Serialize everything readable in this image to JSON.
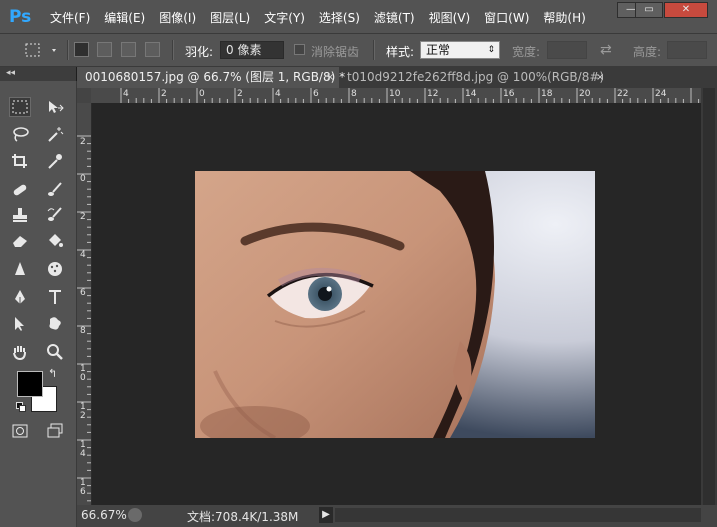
{
  "app": {
    "logo": "Ps"
  },
  "menu": [
    "文件(F)",
    "编辑(E)",
    "图像(I)",
    "图层(L)",
    "文字(Y)",
    "选择(S)",
    "滤镜(T)",
    "视图(V)",
    "窗口(W)",
    "帮助(H)"
  ],
  "window_controls": {
    "minimize": "—",
    "restore": "▭",
    "close": "✕"
  },
  "options": {
    "feather_label": "羽化:",
    "feather_value": "0 像素",
    "antialias_label": "消除锯齿",
    "style_label": "样式:",
    "style_value": "正常",
    "width_label": "宽度:",
    "height_label": "高度:",
    "swap_glyph": "⇄"
  },
  "panel_collapse": "◂◂",
  "tabs": [
    {
      "label": "0010680157.jpg @ 66.7% (图层 1, RGB/8) *",
      "close": "×"
    },
    {
      "label": "t010d9212fe262ff8d.jpg @ 100%(RGB/8#)",
      "close": "×"
    }
  ],
  "ruler": {
    "h_labels": [
      "4",
      "2",
      "0",
      "2",
      "4",
      "6",
      "8",
      "10",
      "12",
      "14",
      "16",
      "18",
      "20",
      "22",
      "24"
    ],
    "v_labels": [
      "2",
      "0",
      "2",
      "4",
      "6",
      "8",
      "1\n0",
      "1\n2",
      "1\n4",
      "1\n6"
    ]
  },
  "status": {
    "zoom": "66.67%",
    "doc": "文档:708.4K/1.38M",
    "arrow": "▶"
  },
  "colors": {
    "accent": "#31a8ff",
    "panel": "#535353",
    "canvas": "#262626",
    "foreground_swatch": "#000000",
    "background_swatch": "#ffffff"
  },
  "icons": [
    "rect-marquee-icon",
    "move-icon",
    "lasso-icon",
    "magic-wand-icon",
    "crop-icon",
    "eyedropper-icon",
    "healing-brush-icon",
    "brush-icon",
    "clone-stamp-icon",
    "history-brush-icon",
    "eraser-icon",
    "paint-bucket-icon",
    "blur-icon",
    "sponge-icon",
    "pen-icon",
    "type-icon",
    "path-select-icon",
    "custom-shape-icon",
    "hand-icon",
    "zoom-icon",
    "quick-mask-icon",
    "screen-mode-icon"
  ]
}
